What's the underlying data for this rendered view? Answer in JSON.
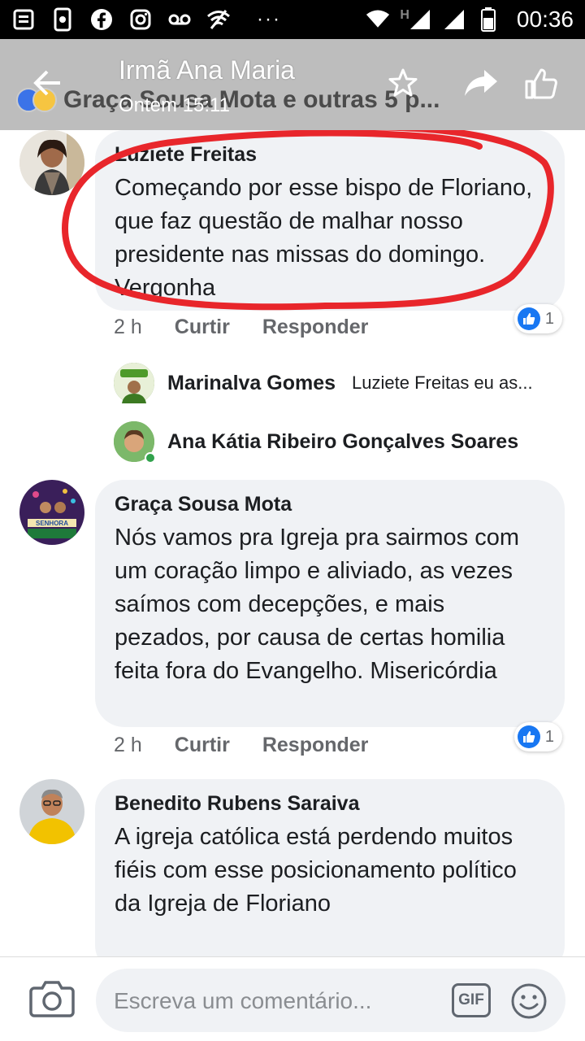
{
  "status_bar": {
    "time": "00:36",
    "more": "···",
    "network": "H"
  },
  "header": {
    "title": "Irmã Ana Maria",
    "subtitle": "Ontem 15:11",
    "behind_text": "Graça Sousa Mota e outras 5 p..."
  },
  "comments": [
    {
      "author": "Luziete Freitas",
      "text": "Começando por esse bispo de Floriano, que faz questão de malhar nosso presidente nas missas do domingo. Vergonha",
      "time": "2 h",
      "like_label": "Curtir",
      "reply_label": "Responder",
      "likes": "1",
      "replies": [
        {
          "author": "Marinalva Gomes",
          "text": "Luziete Freitas eu as..."
        },
        {
          "author": "Ana Kátia Ribeiro Gonçalves Soares",
          "text": ""
        }
      ]
    },
    {
      "author": "Graça Sousa Mota",
      "text": "Nós vamos pra Igreja pra sairmos com um coração limpo e aliviado, as vezes saímos com decepções, e mais pezados, por causa de certas homilia feita fora do Evangelho. Misericórdia",
      "time": "2 h",
      "like_label": "Curtir",
      "reply_label": "Responder",
      "likes": "1"
    },
    {
      "author": "Benedito Rubens Saraiva",
      "text": "A igreja católica está perdendo muitos fiéis com esse posicionamento político da Igreja de Floriano"
    }
  ],
  "composer": {
    "placeholder": "Escreva um comentário...",
    "gif_label": "GIF"
  },
  "colors": {
    "annotation": "#e8262b",
    "like_blue": "#1877f2",
    "bubble": "#f0f2f5"
  }
}
